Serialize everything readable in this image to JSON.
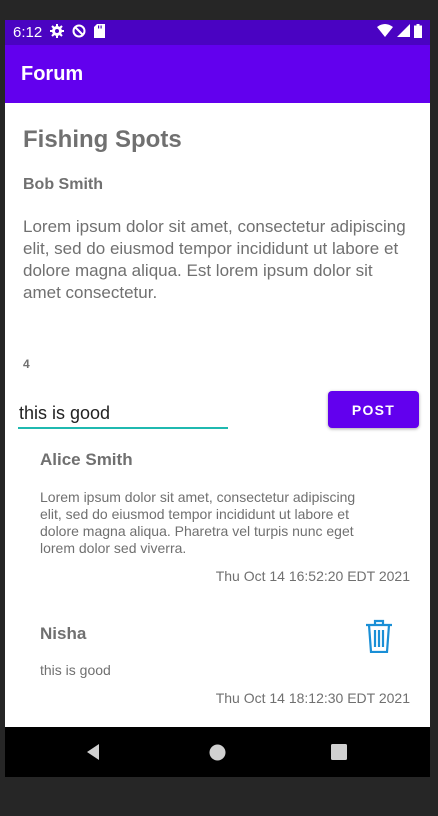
{
  "status": {
    "time": "6:12"
  },
  "app_bar": {
    "title": "Forum"
  },
  "post": {
    "title": "Fishing Spots",
    "author": "Bob Smith",
    "body": "Lorem ipsum dolor sit amet, consectetur adipiscing elit, sed do eiusmod tempor incididunt ut labore et dolore magna aliqua. Est lorem ipsum dolor sit amet consectetur.",
    "comment_count": "4"
  },
  "compose": {
    "value": "this is good",
    "post_label": "POST"
  },
  "comments": [
    {
      "author": "Alice Smith",
      "text": "Lorem ipsum dolor sit amet, consectetur adipiscing elit, sed do eiusmod tempor incididunt ut labore et dolore magna aliqua. Pharetra vel turpis nunc eget lorem dolor sed viverra.",
      "date": "Thu Oct 14 16:52:20 EDT 2021"
    },
    {
      "author": "Nisha",
      "text": "this is good",
      "date": "Thu Oct 14 18:12:30 EDT 2021"
    }
  ],
  "colors": {
    "app_bar": "#6200ee",
    "status_bar": "#4a03c2",
    "accent": "#1fb9b0",
    "trash_icon": "#1a8fd6"
  },
  "icons": {
    "status": [
      "gear-icon",
      "data-saver-icon",
      "sd-card-icon",
      "wifi-icon",
      "signal-icon",
      "battery-icon"
    ],
    "nav": [
      "back-icon",
      "home-icon",
      "recents-icon"
    ],
    "comment_action": "trash-icon"
  }
}
